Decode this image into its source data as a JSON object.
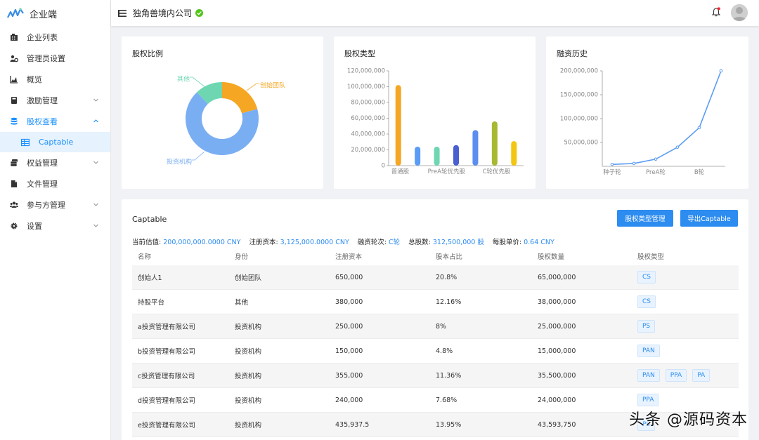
{
  "app": {
    "name": "企业端",
    "company": "独角兽境内公司"
  },
  "sidebar": {
    "items": [
      {
        "label": "企业列表",
        "icon": "building-icon"
      },
      {
        "label": "管理员设置",
        "icon": "users-cog-icon"
      },
      {
        "label": "概览",
        "icon": "area-chart-icon"
      },
      {
        "label": "激励管理",
        "icon": "book-icon",
        "expandable": true
      },
      {
        "label": "股权查看",
        "icon": "database-icon",
        "expandable": true,
        "active": true
      },
      {
        "label": "权益管理",
        "icon": "layers-icon",
        "expandable": true
      },
      {
        "label": "文件管理",
        "icon": "file-icon"
      },
      {
        "label": "参与方管理",
        "icon": "group-icon",
        "expandable": true
      },
      {
        "label": "设置",
        "icon": "gear-icon",
        "expandable": true
      }
    ],
    "subitem": {
      "label": "Captable",
      "icon": "table-icon"
    }
  },
  "cards": {
    "pie": {
      "title": "股权比例"
    },
    "bar": {
      "title": "股权类型"
    },
    "line": {
      "title": "融资历史"
    }
  },
  "chart_data": [
    {
      "type": "pie",
      "title": "股权比例",
      "slices": [
        {
          "name": "创始团队",
          "value": 20.8,
          "color": "#f5a623"
        },
        {
          "name": "投资机构",
          "value": 67.04,
          "color": "#7aaef2"
        },
        {
          "name": "其他",
          "value": 12.16,
          "color": "#6ed7b1"
        }
      ]
    },
    {
      "type": "bar",
      "title": "股权类型",
      "categories": [
        "普通股",
        "",
        "PreA轮优先股",
        "",
        "",
        "C轮优先股"
      ],
      "bar_values": [
        102000000,
        24000000,
        24000000,
        26000000,
        45000000,
        56000000,
        31000000
      ],
      "bar_colors": [
        "#f5a623",
        "#5b9cf5",
        "#6ed7b1",
        "#4a5fd0",
        "#5b8ef0",
        "#a8b832",
        "#f2c612"
      ],
      "ylim": [
        0,
        120000000
      ],
      "yticks": [
        "0",
        "20,000,000",
        "40,000,000",
        "60,000,000",
        "80,000,000",
        "100,000,000",
        "120,000,000"
      ]
    },
    {
      "type": "line",
      "title": "融资历史",
      "x": [
        "种子轮",
        "PreA轮",
        "B轮"
      ],
      "values": [
        4000000,
        6000000,
        15000000,
        40000000,
        81000000,
        200000000
      ],
      "ylim": [
        0,
        200000000
      ],
      "yticks": [
        "50,000,000",
        "100,000,000",
        "150,000,000",
        "200,000,000"
      ],
      "color": "#5b9cf5"
    }
  ],
  "captable": {
    "title": "Captable",
    "btn_types": "股权类型管理",
    "btn_export": "导出Captable",
    "summary": {
      "valuation_label": "当前估值:",
      "valuation": "200,000,000.0000 CNY",
      "capital_label": "注册资本:",
      "capital": "3,125,000.0000 CNY",
      "round_label": "融资轮次:",
      "round": "C轮",
      "shares_label": "总股数:",
      "shares": "312,500,000 股",
      "price_label": "每股单价:",
      "price": "0.64 CNY"
    },
    "headers": [
      "名称",
      "身份",
      "注册资本",
      "股本占比",
      "股权数量",
      "股权类型"
    ],
    "rows": [
      {
        "name": "创始人1",
        "role": "创始团队",
        "capital": "650,000",
        "ratio": "20.8%",
        "count": "65,000,000",
        "types": [
          "CS"
        ]
      },
      {
        "name": "持股平台",
        "role": "其他",
        "capital": "380,000",
        "ratio": "12.16%",
        "count": "38,000,000",
        "types": [
          "CS"
        ]
      },
      {
        "name": "a投资管理有限公司",
        "role": "投资机构",
        "capital": "250,000",
        "ratio": "8%",
        "count": "25,000,000",
        "types": [
          "PS"
        ]
      },
      {
        "name": "b投资管理有限公司",
        "role": "投资机构",
        "capital": "150,000",
        "ratio": "4.8%",
        "count": "15,000,000",
        "types": [
          "PAN"
        ]
      },
      {
        "name": "c投资管理有限公司",
        "role": "投资机构",
        "capital": "355,000",
        "ratio": "11.36%",
        "count": "35,500,000",
        "types": [
          "PAN",
          "PPA",
          "PA"
        ]
      },
      {
        "name": "d投资管理有限公司",
        "role": "投资机构",
        "capital": "240,000",
        "ratio": "7.68%",
        "count": "24,000,000",
        "types": [
          "PPA"
        ]
      },
      {
        "name": "e投资管理有限公司",
        "role": "投资机构",
        "capital": "435,937.5",
        "ratio": "13.95%",
        "count": "43,593,750",
        "types": [
          "PS"
        ]
      }
    ]
  },
  "watermark": "头条 @源码资本"
}
